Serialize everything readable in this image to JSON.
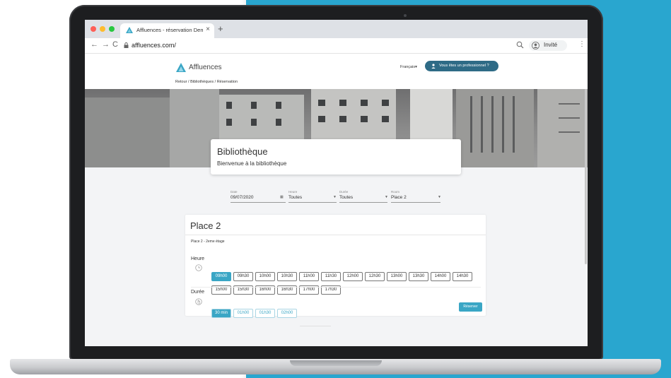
{
  "browser": {
    "tab_title": "Affluences - réservation Demo",
    "tab_close": "×",
    "new_tab": "+",
    "url": "affluences.com/",
    "profile_label": "Invité",
    "back": "←",
    "forward": "→",
    "reload": "C",
    "menu": "⋮"
  },
  "site": {
    "logo_text": "Affluences",
    "breadcrumb": "Retour  /  Bibliothèques  /  Réservation",
    "language": "Français▾",
    "pro_button": "Vous êtes un professionnel ?"
  },
  "hero": {
    "title": "Bibliothèque",
    "subtitle": "Bienvenue à la bibliothèque"
  },
  "filters": [
    {
      "label": "Date",
      "value": "09/07/2020"
    },
    {
      "label": "Heure",
      "value": "Toutes"
    },
    {
      "label": "Durée",
      "value": "Toutes"
    },
    {
      "label": "Room",
      "value": "Place 2"
    }
  ],
  "booking": {
    "title": "Place 2",
    "subtitle": "Place 2 - 2eme étage",
    "hour_label": "Heure",
    "hours_row1": [
      "09h00",
      "09h30",
      "10h00",
      "10h30",
      "11h00",
      "11h30",
      "12h00",
      "12h30",
      "13h00",
      "13h30",
      "14h00",
      "14h30"
    ],
    "hours_row2": [
      "15h00",
      "15h30",
      "16h00",
      "16h30",
      "17h00",
      "17h30"
    ],
    "selected_hour": "09h00",
    "duration_label": "Durée",
    "durations": [
      "30 min",
      "01h00",
      "01h30",
      "02h00"
    ],
    "selected_duration": "30 min",
    "reserve_label": "Réserver"
  },
  "colors": {
    "background": "#29a6cf",
    "accent": "#3aa6c5",
    "pro_button": "#2e6b86"
  }
}
